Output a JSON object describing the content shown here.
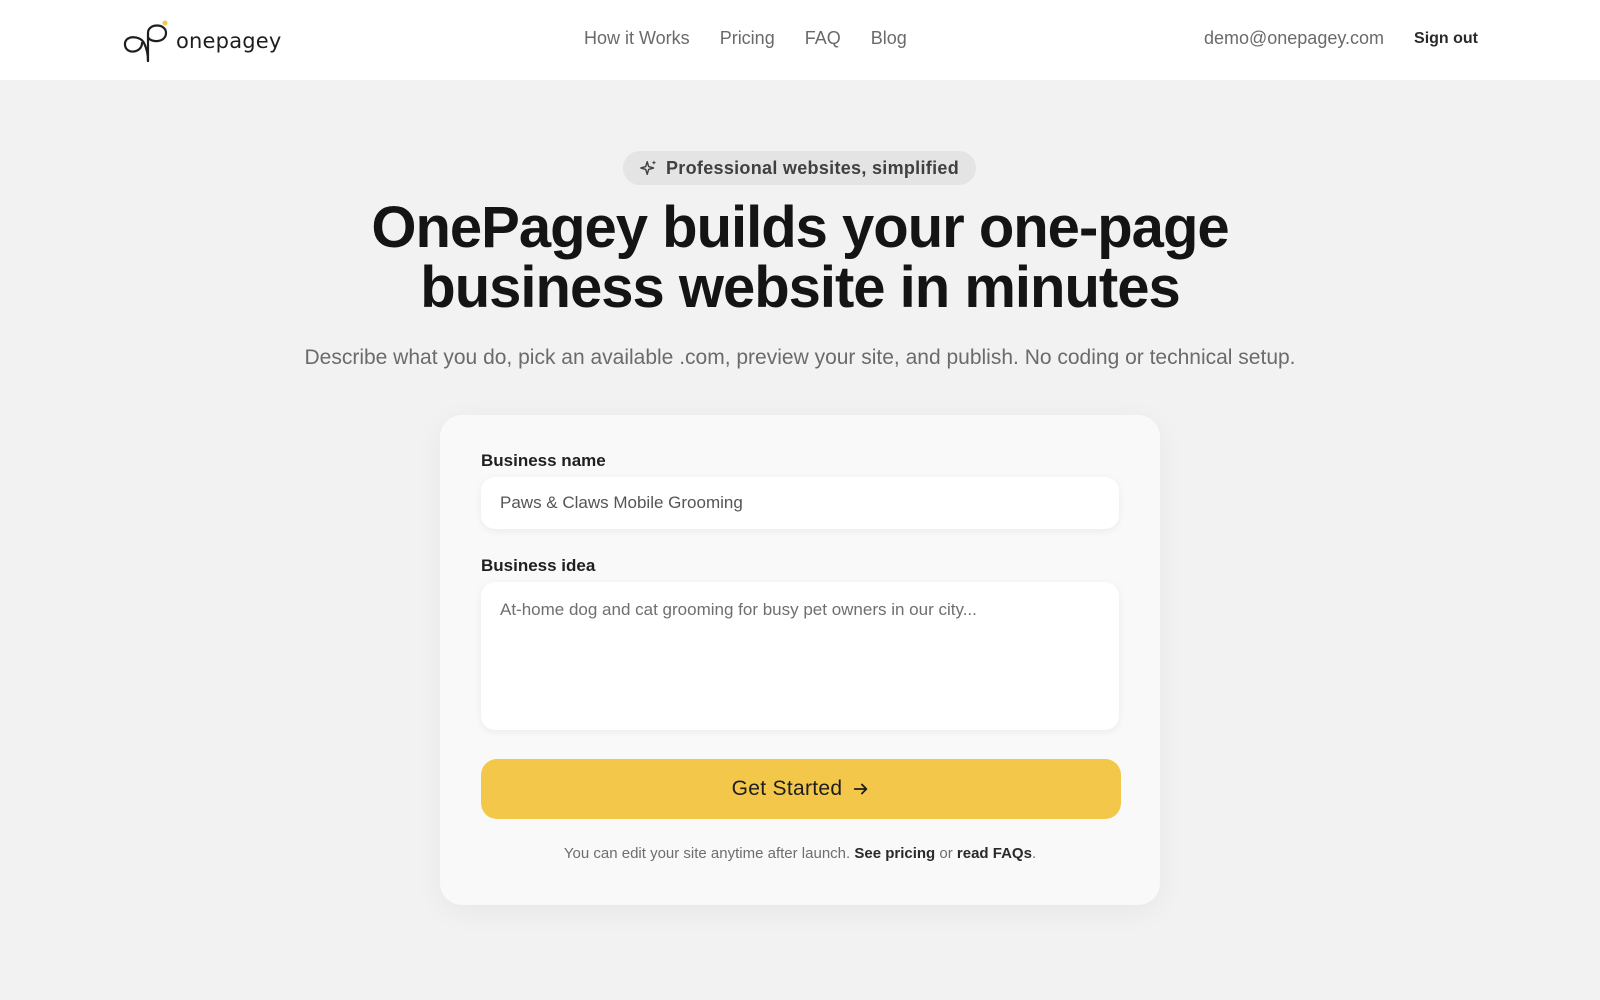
{
  "brand": {
    "name": "onepagey",
    "accent_color": "#f3c84a"
  },
  "nav": {
    "items": [
      "How it Works",
      "Pricing",
      "FAQ",
      "Blog"
    ]
  },
  "user": {
    "email": "demo@onepagey.com",
    "signout_label": "Sign out"
  },
  "hero": {
    "badge": "Professional websites, simplified",
    "headline_line1": "OnePagey builds your one-page",
    "headline_line2": "business website in minutes",
    "subhead": "Describe what you do, pick an available .com, preview your site, and publish. No coding or technical setup."
  },
  "form": {
    "business_name_label": "Business name",
    "business_name_value": "Paws & Claws Mobile Grooming",
    "business_idea_label": "Business idea",
    "business_idea_placeholder": "At-home dog and cat grooming for busy pet owners in our city...",
    "submit_label": "Get Started",
    "footnote_prefix": "You can edit your site anytime after launch.",
    "footnote_link1": "See pricing",
    "footnote_mid": "or",
    "footnote_link2": "read FAQs",
    "footnote_suffix": "."
  }
}
